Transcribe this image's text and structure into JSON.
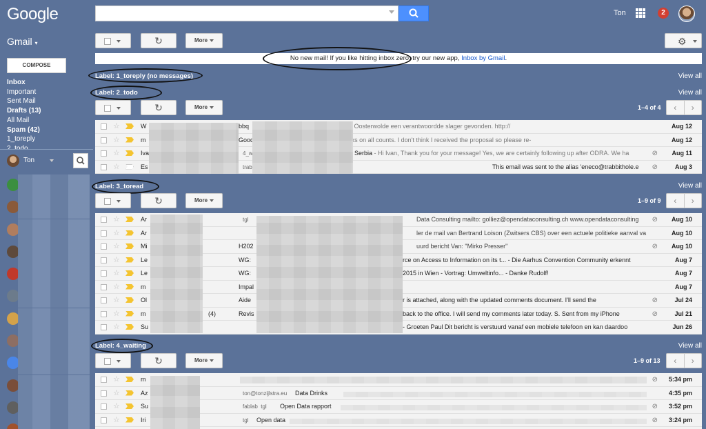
{
  "header": {
    "logo": "Google",
    "user_name": "Ton",
    "notification_count": "2"
  },
  "sidebar": {
    "app_label": "Gmail",
    "compose_label": "COMPOSE",
    "items": [
      {
        "label": "Inbox",
        "bold": true
      },
      {
        "label": "Important",
        "bold": false
      },
      {
        "label": "Sent Mail",
        "bold": false
      },
      {
        "label": "Drafts (13)",
        "bold": true
      },
      {
        "label": "All Mail",
        "bold": false
      },
      {
        "label": "Spam (42)",
        "bold": true
      },
      {
        "label": "1_toreply",
        "bold": false
      },
      {
        "label": "2_todo",
        "bold": false
      }
    ],
    "hangouts_user": "Ton"
  },
  "toolbar": {
    "more_label": "More"
  },
  "banner": {
    "text": "No new mail! If you like hitting inbox zero, try our new app, ",
    "link": "Inbox by Gmail",
    "end": "."
  },
  "sections": {
    "toreply": {
      "title": "Label: 1_toreply (no messages)",
      "view_all": "View all"
    },
    "todo": {
      "title": "Label: 2_todo",
      "view_all": "View all",
      "more": "More",
      "pager": "1–4 of 4",
      "rows": [
        {
          "sender": "W",
          "subject": "bbq",
          "snippet": "rwerk heb ik in Oosterwolde een verantwoordde slager gevonden. http://",
          "date": "Aug 12",
          "imp": "y",
          "clip": false
        },
        {
          "sender": "m",
          "subject": "Good",
          "snippet": "ise, and thanks on all counts. I don't think I received the proposal so please re-",
          "date": "Aug 12",
          "imp": "y",
          "clip": false
        },
        {
          "sender": "Iva",
          "tag": "4_w",
          "subject": "Serbia",
          "snippet": " - Hi Ivan, Thank you for your message! Yes, we are certainly following up after ODRA. We ha",
          "date": "Aug 11",
          "imp": "y",
          "clip": true
        },
        {
          "sender": "Es",
          "tag": "trabl",
          "subject": "",
          "snippet": "This email was sent to the alias 'eneco@trabbithole.e",
          "date": "Aug 3",
          "imp": "n",
          "clip": true
        }
      ]
    },
    "toread": {
      "title": "Label: 3_toread",
      "view_all": "View all",
      "more": "More",
      "pager": "1–9 of 9",
      "rows": [
        {
          "sender": "Ar",
          "tag": "tgl",
          "subject": "",
          "snippet": "Data Consulting mailto: golliez@opendataconsulting.ch www.opendataconsulting",
          "date": "Aug 10",
          "imp": "y",
          "clip": true
        },
        {
          "sender": "Ar",
          "tag": "",
          "subject": "",
          "snippet": "ler de mail van Bertrand Loison (Zwitsers CBS) over een actuele politieke aanval va",
          "date": "Aug 10",
          "imp": "y",
          "clip": false
        },
        {
          "sender": "Mi",
          "tag": "",
          "subject": "H202",
          "snippet": "uurd bericht Van: \"Mirko Presser\"",
          "date": "Aug 10",
          "imp": "y",
          "clip": true
        },
        {
          "sender": "Le",
          "tag": "",
          "subject": "WG: ",
          "snippet": "rce on Access to Information on its t... - Die Aarhus Convention Community erkennt",
          "date": "Aug 7",
          "imp": "y",
          "clip": false
        },
        {
          "sender": "Le",
          "tag": "",
          "subject": "WG: ",
          "snippet": "2015 in Wien - Vortrag: Umweltinfo... - Danke Rudolf!",
          "date": "Aug 7",
          "imp": "y",
          "clip": false
        },
        {
          "sender": "m",
          "tag": "",
          "subject": "Impal",
          "snippet": "",
          "date": "Aug 7",
          "imp": "y",
          "clip": false
        },
        {
          "sender": "Ol",
          "tag": "",
          "subject": "Aide",
          "snippet": "r is attached, along with the updated comments document. I'll send the",
          "date": "Jul 24",
          "imp": "y",
          "clip": true
        },
        {
          "sender": "m",
          "tag": "(4)",
          "subject": "Revis",
          "snippet": "back to the office. I will send my comments later today. S. Sent from my iPhone",
          "date": "Jul 21",
          "imp": "y",
          "clip": true
        },
        {
          "sender": "Su",
          "tag": "",
          "subject": "",
          "snippet": " - Groeten Paul Dit bericht is verstuurd vanaf een mobiele telefoon en kan daardoo",
          "date": "Jun 26",
          "imp": "y",
          "clip": false
        }
      ]
    },
    "waiting": {
      "title": "Label: 4_waiting",
      "view_all": "View all",
      "more": "More",
      "pager": "1–9 of 13",
      "rows": [
        {
          "sender": "m",
          "tag": "",
          "subject": "",
          "snippet": "",
          "date": "5:34 pm",
          "imp": "y",
          "clip": true
        },
        {
          "sender": "Az",
          "tag": "ton@tonzijlstra.eu",
          "subject": "Data Drinks",
          "snippet": "",
          "date": "4:35 pm",
          "imp": "y",
          "clip": false
        },
        {
          "sender": "Su",
          "tag": "fablab  tgl",
          "subject": "Open Data rapport",
          "snippet": "",
          "date": "3:52 pm",
          "imp": "y",
          "clip": true
        },
        {
          "sender": "Iri",
          "tag": "tgl",
          "subject": "Open data",
          "snippet": "",
          "date": "3:24 pm",
          "imp": "y",
          "clip": true
        }
      ]
    }
  }
}
